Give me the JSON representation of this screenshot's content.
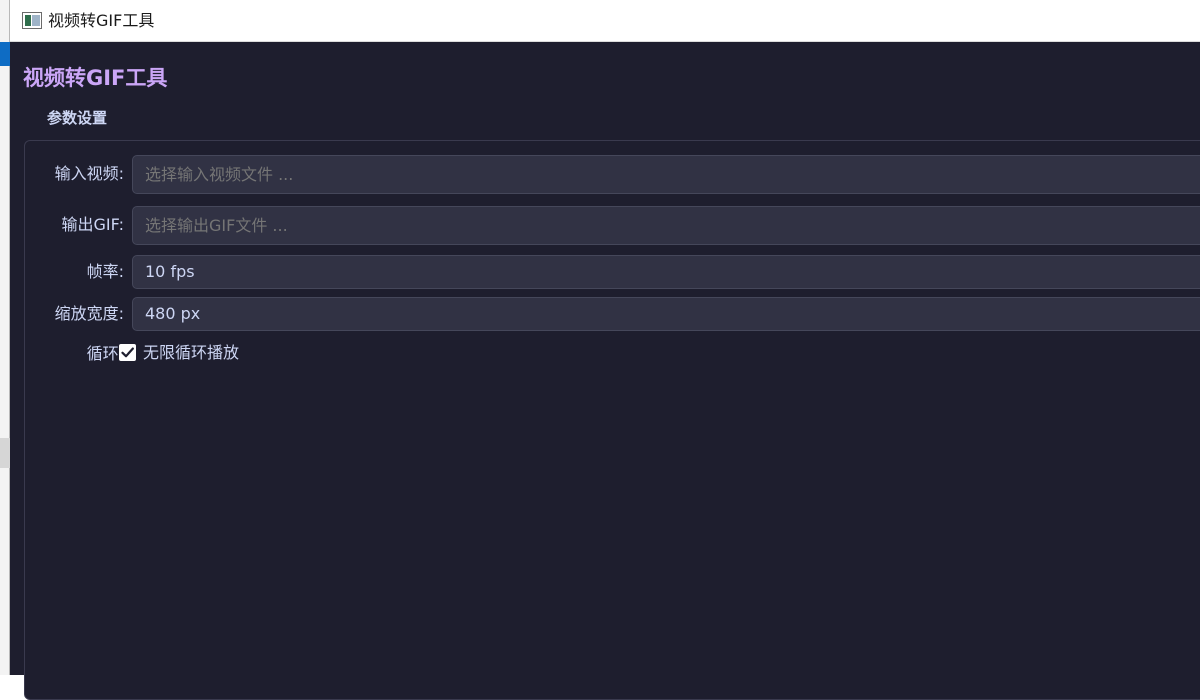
{
  "window": {
    "title": "视频转GIF工具"
  },
  "app": {
    "heading": "视频转GIF工具"
  },
  "settings": {
    "group_title": "参数设置",
    "input_video": {
      "label": "输入视频:",
      "value": "",
      "placeholder": "选择输入视频文件 ..."
    },
    "output_gif": {
      "label": "输出GIF:",
      "value": "",
      "placeholder": "选择输出GIF文件 ..."
    },
    "frame_rate": {
      "label": "帧率:",
      "value": "10 fps"
    },
    "scale_width": {
      "label": "缩放宽度:",
      "value": "480 px"
    },
    "loop": {
      "label": "循环:",
      "checkbox_label": "无限循环播放",
      "checked": true
    }
  },
  "icons": {
    "app": "app-window-icon",
    "check": "checkmark-icon"
  },
  "colors": {
    "background": "#1e1e2e",
    "accent": "#cba6f7",
    "field_bg": "#313244",
    "text": "#cdd6f4",
    "placeholder": "#7f849c"
  }
}
